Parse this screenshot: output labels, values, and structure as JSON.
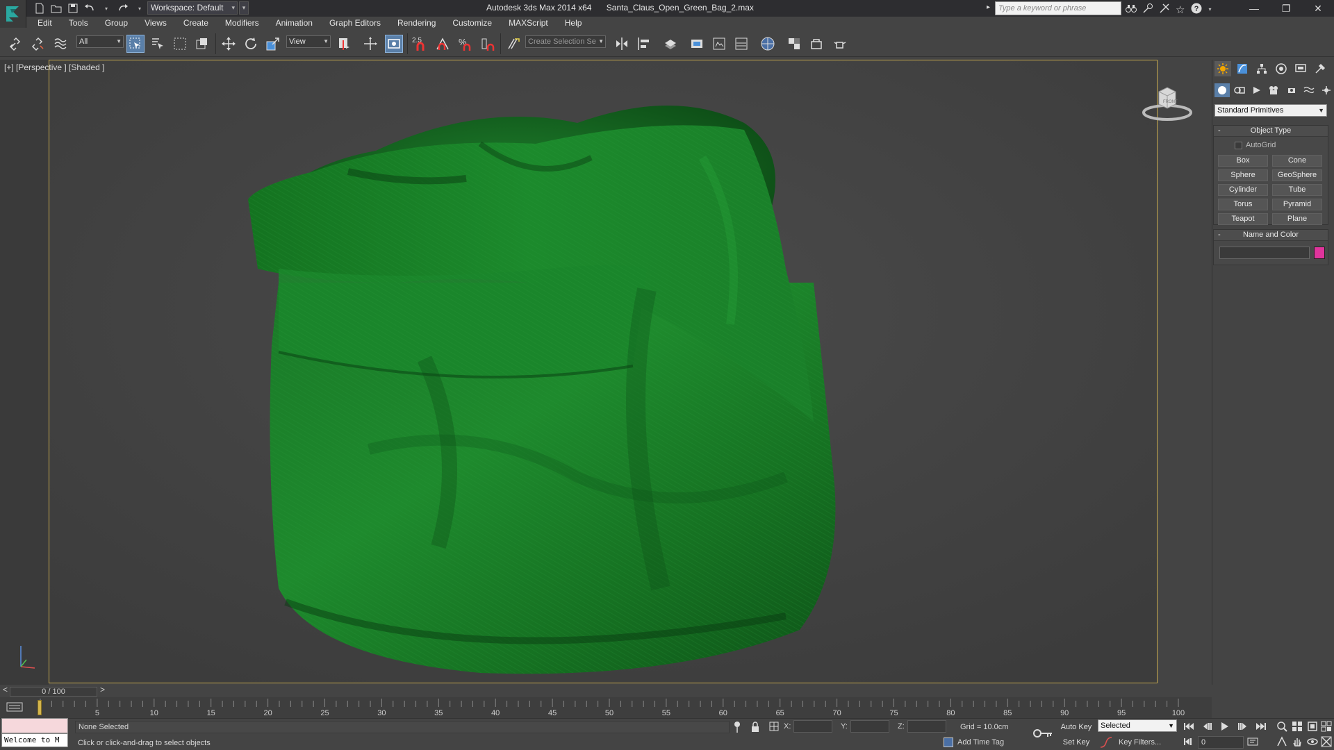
{
  "titlebar": {
    "workspace_label": "Workspace: Default",
    "app_name": "Autodesk 3ds Max  2014 x64",
    "file_name": "Santa_Claus_Open_Green_Bag_2.max",
    "search_placeholder": "Type a keyword or phrase"
  },
  "menu": [
    "Edit",
    "Tools",
    "Group",
    "Views",
    "Create",
    "Modifiers",
    "Animation",
    "Graph Editors",
    "Rendering",
    "Customize",
    "MAXScript",
    "Help"
  ],
  "toolbar": {
    "selection_filter": "All",
    "ref_coord": "View",
    "snap_label": "2.5",
    "named_selection_placeholder": "Create Selection Se"
  },
  "viewport": {
    "label": "[+] [Perspective ] [Shaded ]",
    "viewcube_label": "FRONT",
    "bag_color": "#1f7a2a"
  },
  "command_panel": {
    "category": "Standard Primitives",
    "object_type_title": "Object Type",
    "autogrid_label": "AutoGrid",
    "primitives": [
      "Box",
      "Cone",
      "Sphere",
      "GeoSphere",
      "Cylinder",
      "Tube",
      "Torus",
      "Pyramid",
      "Teapot",
      "Plane"
    ],
    "name_color_title": "Name and Color",
    "object_color": "#e0349c"
  },
  "timeline": {
    "slider_label": "0 / 100",
    "prev": "<",
    "next": ">",
    "ticks": [
      "5",
      "10",
      "15",
      "20",
      "25",
      "30",
      "35",
      "40",
      "45",
      "50",
      "55",
      "60",
      "65",
      "70",
      "75",
      "80",
      "85",
      "90",
      "95",
      "100"
    ]
  },
  "status": {
    "maxscript_welcome": "Welcome to M",
    "selection_status": "None Selected",
    "prompt": "Click or click-and-drag to select objects",
    "x_label": "X:",
    "y_label": "Y:",
    "z_label": "Z:",
    "grid": "Grid = 10.0cm",
    "add_time_tag": "Add Time Tag",
    "auto_key": "Auto Key",
    "set_key": "Set Key",
    "key_mode": "Selected",
    "key_filters": "Key Filters...",
    "current_frame": "0"
  }
}
